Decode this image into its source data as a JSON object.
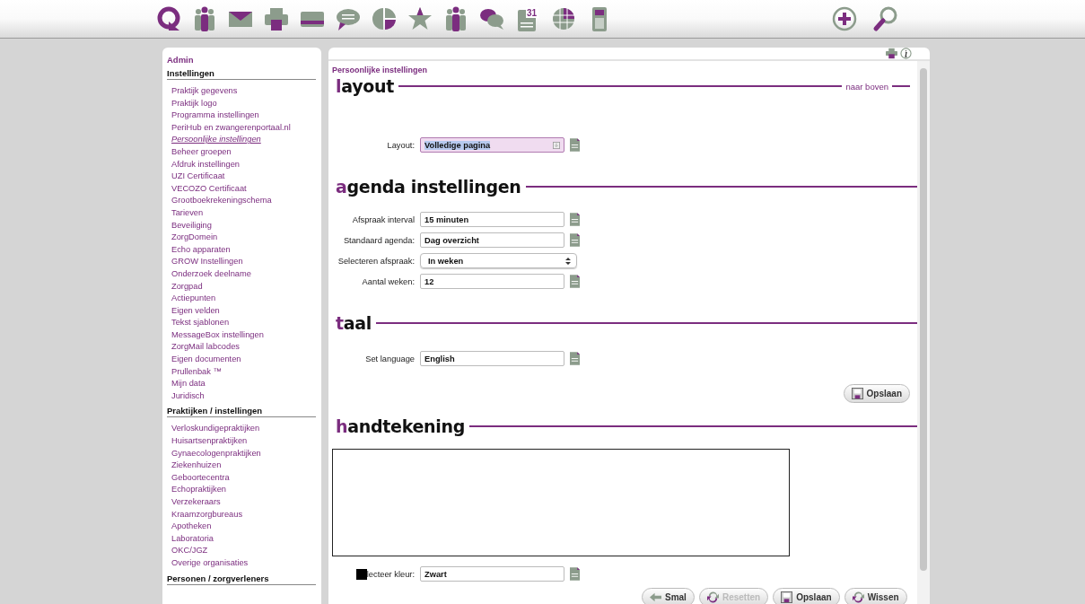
{
  "toolbar": {
    "calendar_day": "31"
  },
  "sidebar": {
    "title": "Admin",
    "groups": [
      {
        "heading": "Instellingen",
        "items": [
          {
            "label": "Praktijk gegevens",
            "selected": false
          },
          {
            "label": "Praktijk logo",
            "selected": false
          },
          {
            "label": "Programma instellingen",
            "selected": false
          },
          {
            "label": "PeriHub en zwangerenportaal.nl",
            "selected": false
          },
          {
            "label": "Persoonlijke instellingen",
            "selected": true
          },
          {
            "label": "Beheer groepen",
            "selected": false
          },
          {
            "label": "Afdruk instellingen",
            "selected": false
          },
          {
            "label": "UZI Certificaat",
            "selected": false
          },
          {
            "label": "VECOZO Certificaat",
            "selected": false
          },
          {
            "label": "Grootboekrekeningschema",
            "selected": false
          },
          {
            "label": "Tarieven",
            "selected": false
          },
          {
            "label": "Beveiliging",
            "selected": false
          },
          {
            "label": "ZorgDomein",
            "selected": false
          },
          {
            "label": "Echo apparaten",
            "selected": false
          },
          {
            "label": "GROW Instellingen",
            "selected": false
          },
          {
            "label": "Onderzoek deelname",
            "selected": false
          },
          {
            "label": "Zorgpad",
            "selected": false
          },
          {
            "label": "Actiepunten",
            "selected": false
          },
          {
            "label": "Eigen velden",
            "selected": false
          },
          {
            "label": "Tekst sjablonen",
            "selected": false
          },
          {
            "label": "MessageBox instellingen",
            "selected": false
          },
          {
            "label": "ZorgMail labcodes",
            "selected": false
          },
          {
            "label": "Eigen documenten",
            "selected": false
          },
          {
            "label": "Prullenbak ™",
            "selected": false
          },
          {
            "label": "Mijn data",
            "selected": false
          },
          {
            "label": "Juridisch",
            "selected": false
          }
        ]
      },
      {
        "heading": "Praktijken / instellingen",
        "items": [
          {
            "label": "Verloskundigepraktijken",
            "selected": false
          },
          {
            "label": "Huisartsenpraktijken",
            "selected": false
          },
          {
            "label": "Gynaecologenpraktijken",
            "selected": false
          },
          {
            "label": "Ziekenhuizen",
            "selected": false
          },
          {
            "label": "Geboortecentra",
            "selected": false
          },
          {
            "label": "Echopraktijken",
            "selected": false
          },
          {
            "label": "Verzekeraars",
            "selected": false
          },
          {
            "label": "Kraamzorgbureaus",
            "selected": false
          },
          {
            "label": "Apotheken",
            "selected": false
          },
          {
            "label": "Laboratoria",
            "selected": false
          },
          {
            "label": "OKC/JGZ",
            "selected": false
          },
          {
            "label": "Overige organisaties",
            "selected": false
          }
        ]
      },
      {
        "heading": "Personen / zorgverleners"
      }
    ]
  },
  "page": {
    "breadcrumb": "Persoonlijke instellingen",
    "sections": [
      {
        "title": "layout",
        "kind": "form",
        "top_link": "naar boven",
        "rows": [
          {
            "label": "Layout:",
            "value": "Volledige pagina",
            "kind": "highlighted-select",
            "note": true
          }
        ]
      },
      {
        "title": "agenda instellingen",
        "kind": "form",
        "rows": [
          {
            "label": "Afspraak interval",
            "value": "15 minuten",
            "kind": "text",
            "note": true
          },
          {
            "label": "Standaard agenda:",
            "value": "Dag overzicht",
            "kind": "text",
            "note": true
          },
          {
            "label": "Selecteren afspraak:",
            "value": "In weken",
            "kind": "select",
            "note": false
          },
          {
            "label": "Aantal weken:",
            "value": "12",
            "kind": "text",
            "note": true
          }
        ]
      },
      {
        "title": "taal",
        "kind": "form",
        "rows": [
          {
            "label": "Set language",
            "value": "English",
            "kind": "text",
            "note": true
          }
        ],
        "buttons": [
          {
            "label": "Opslaan",
            "disabled": false
          }
        ]
      },
      {
        "title": "handtekening",
        "kind": "signature",
        "rows": [
          {
            "label": "lecteer kleur:",
            "value": "Zwart",
            "kind": "color",
            "color": "#000000",
            "note": true
          }
        ],
        "buttons": [
          {
            "label": "Smal",
            "disabled": false
          },
          {
            "label": "Resetten",
            "disabled": true
          },
          {
            "label": "Opslaan",
            "disabled": false
          },
          {
            "label": "Wissen",
            "disabled": false
          }
        ]
      }
    ]
  }
}
